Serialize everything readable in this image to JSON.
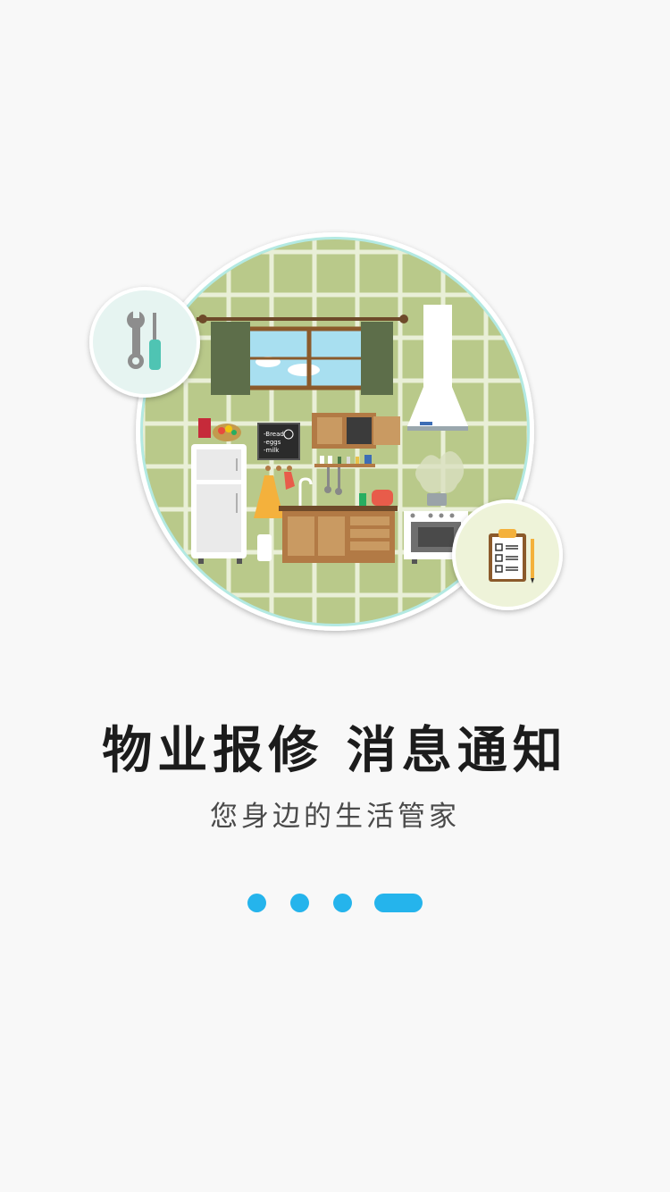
{
  "onboarding": {
    "title": "物业报修  消息通知",
    "subtitle": "您身边的生活管家",
    "current_page": 4,
    "page_count": 4,
    "accent_color": "#25b4ec",
    "illustration": {
      "scene": "kitchen",
      "blackboard_lines": [
        "-Bread",
        "-eggs",
        "-milk"
      ],
      "badge_left_icon": "wrench-screwdriver-icon",
      "badge_right_icon": "clipboard-checklist-icon"
    }
  }
}
